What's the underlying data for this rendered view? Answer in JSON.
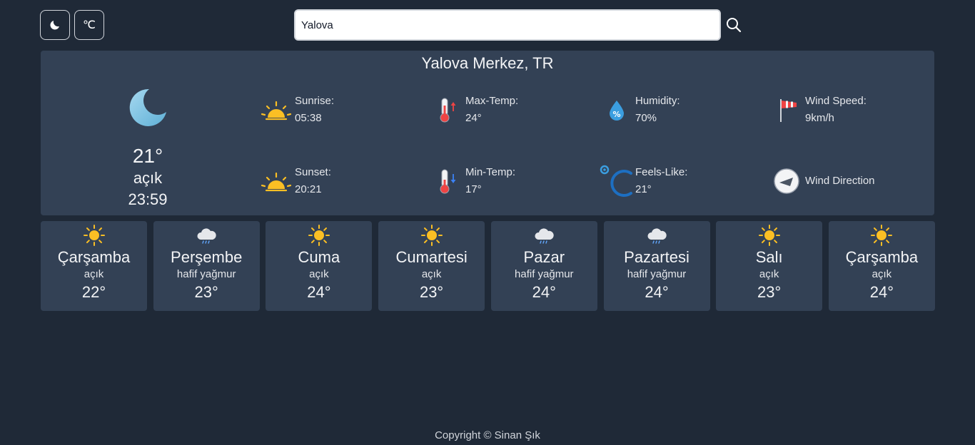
{
  "header": {
    "theme_icon": "moon-icon",
    "unit_label": "℃",
    "search_value": "Yalova",
    "search_icon": "search-icon"
  },
  "current": {
    "location": "Yalova Merkez, TR",
    "icon": "moon-icon",
    "temp": "21°",
    "description": "açık",
    "time": "23:59"
  },
  "stats": {
    "sunrise": {
      "label": "Sunrise:",
      "value": "05:38",
      "icon": "sunrise-icon"
    },
    "sunset": {
      "label": "Sunset:",
      "value": "20:21",
      "icon": "sunset-icon"
    },
    "max_temp": {
      "label": "Max-Temp:",
      "value": "24°",
      "icon": "thermometer-up-icon"
    },
    "min_temp": {
      "label": "Min-Temp:",
      "value": "17°",
      "icon": "thermometer-down-icon"
    },
    "humidity": {
      "label": "Humidity:",
      "value": "70%",
      "icon": "humidity-drop-icon"
    },
    "feels_like": {
      "label": "Feels-Like:",
      "value": "21°",
      "icon": "feels-like-icon"
    },
    "wind_speed": {
      "label": "Wind Speed:",
      "value": "9km/h",
      "icon": "windsock-icon"
    },
    "wind_direction": {
      "label": "Wind Direction",
      "icon": "compass-icon"
    }
  },
  "forecast": [
    {
      "day": "Çarşamba",
      "desc": "açık",
      "temp": "22°",
      "icon": "sun-icon"
    },
    {
      "day": "Perşembe",
      "desc": "hafif yağmur",
      "temp": "23°",
      "icon": "rain-cloud-icon"
    },
    {
      "day": "Cuma",
      "desc": "açık",
      "temp": "24°",
      "icon": "sun-icon"
    },
    {
      "day": "Cumartesi",
      "desc": "açık",
      "temp": "23°",
      "icon": "sun-icon"
    },
    {
      "day": "Pazar",
      "desc": "hafif yağmur",
      "temp": "24°",
      "icon": "rain-cloud-icon"
    },
    {
      "day": "Pazartesi",
      "desc": "hafif yağmur",
      "temp": "24°",
      "icon": "rain-cloud-icon"
    },
    {
      "day": "Salı",
      "desc": "açık",
      "temp": "23°",
      "icon": "sun-icon"
    },
    {
      "day": "Çarşamba",
      "desc": "açık",
      "temp": "24°",
      "icon": "sun-icon"
    }
  ],
  "footer": {
    "copyright": "Copyright © Sinan Şık"
  },
  "colors": {
    "background": "#1f2937",
    "card": "#334155",
    "sun": "#fbbf24",
    "thermo_red": "#ef4444",
    "accent_blue": "#3b82f6"
  }
}
